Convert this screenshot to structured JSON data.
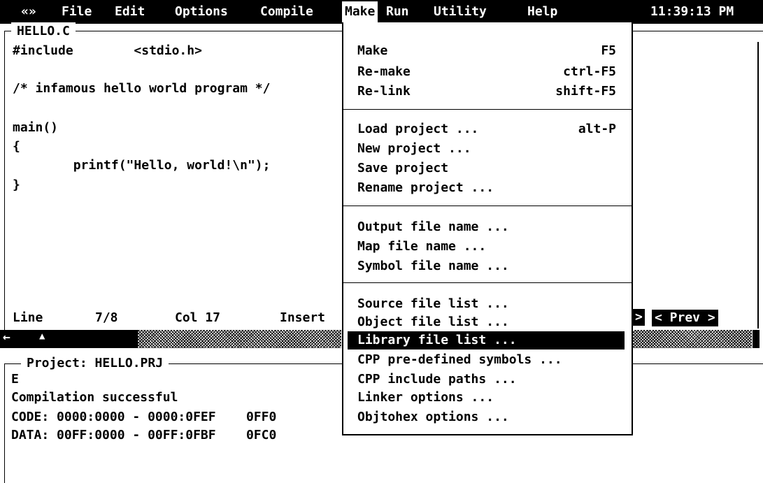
{
  "menubar": {
    "system": "«»",
    "items": [
      "File",
      "Edit",
      "Options",
      "Compile",
      "Make",
      "Run",
      "Utility",
      "Help"
    ],
    "active": "Make",
    "clock": "11:39:13 PM"
  },
  "editor": {
    "title": "HELLO.C",
    "lines": [
      "#include        <stdio.h>",
      "",
      "/* infamous hello world program */",
      "",
      "main()",
      "{",
      "        printf(\"Hello, world!\\n\");",
      "}"
    ],
    "status": {
      "line_label": "Line",
      "line_value": "7/8",
      "col_label": "Col 17",
      "mode": "Insert"
    },
    "scroll_left": "←",
    "scroll_up": "▲"
  },
  "project": {
    "title": "Project: HELLO.PRJ",
    "lines": [
      "E",
      "Compilation successful",
      "CODE: 0000:0000 - 0000:0FEF    0FF0",
      "DATA: 00FF:0000 - 00FF:0FBF    0FC0"
    ]
  },
  "make_menu": {
    "groups": [
      [
        {
          "label": "Make",
          "shortcut": "F5"
        },
        {
          "label": "Re-make",
          "shortcut": "ctrl-F5"
        },
        {
          "label": "Re-link",
          "shortcut": "shift-F5"
        }
      ],
      [
        {
          "label": "Load project ...",
          "shortcut": "alt-P"
        },
        {
          "label": "New project ...",
          "shortcut": ""
        },
        {
          "label": "Save project",
          "shortcut": ""
        },
        {
          "label": "Rename project ...",
          "shortcut": ""
        }
      ],
      [
        {
          "label": "Output file name ...",
          "shortcut": ""
        },
        {
          "label": "Map file name ...",
          "shortcut": ""
        },
        {
          "label": "Symbol file name ...",
          "shortcut": ""
        }
      ],
      [
        {
          "label": "Source file list ...",
          "shortcut": ""
        },
        {
          "label": "Object file list ...",
          "shortcut": ""
        },
        {
          "label": "Library file list ...",
          "shortcut": ""
        },
        {
          "label": "CPP pre-defined symbols ...",
          "shortcut": ""
        },
        {
          "label": "CPP include paths ...",
          "shortcut": ""
        },
        {
          "label": "Linker options ...",
          "shortcut": ""
        },
        {
          "label": "Objtohex options ...",
          "shortcut": ""
        }
      ]
    ],
    "selected": "Library file list ..."
  },
  "right_panel": {
    "prev_arrow": ">",
    "prev_button": "< Prev >"
  }
}
